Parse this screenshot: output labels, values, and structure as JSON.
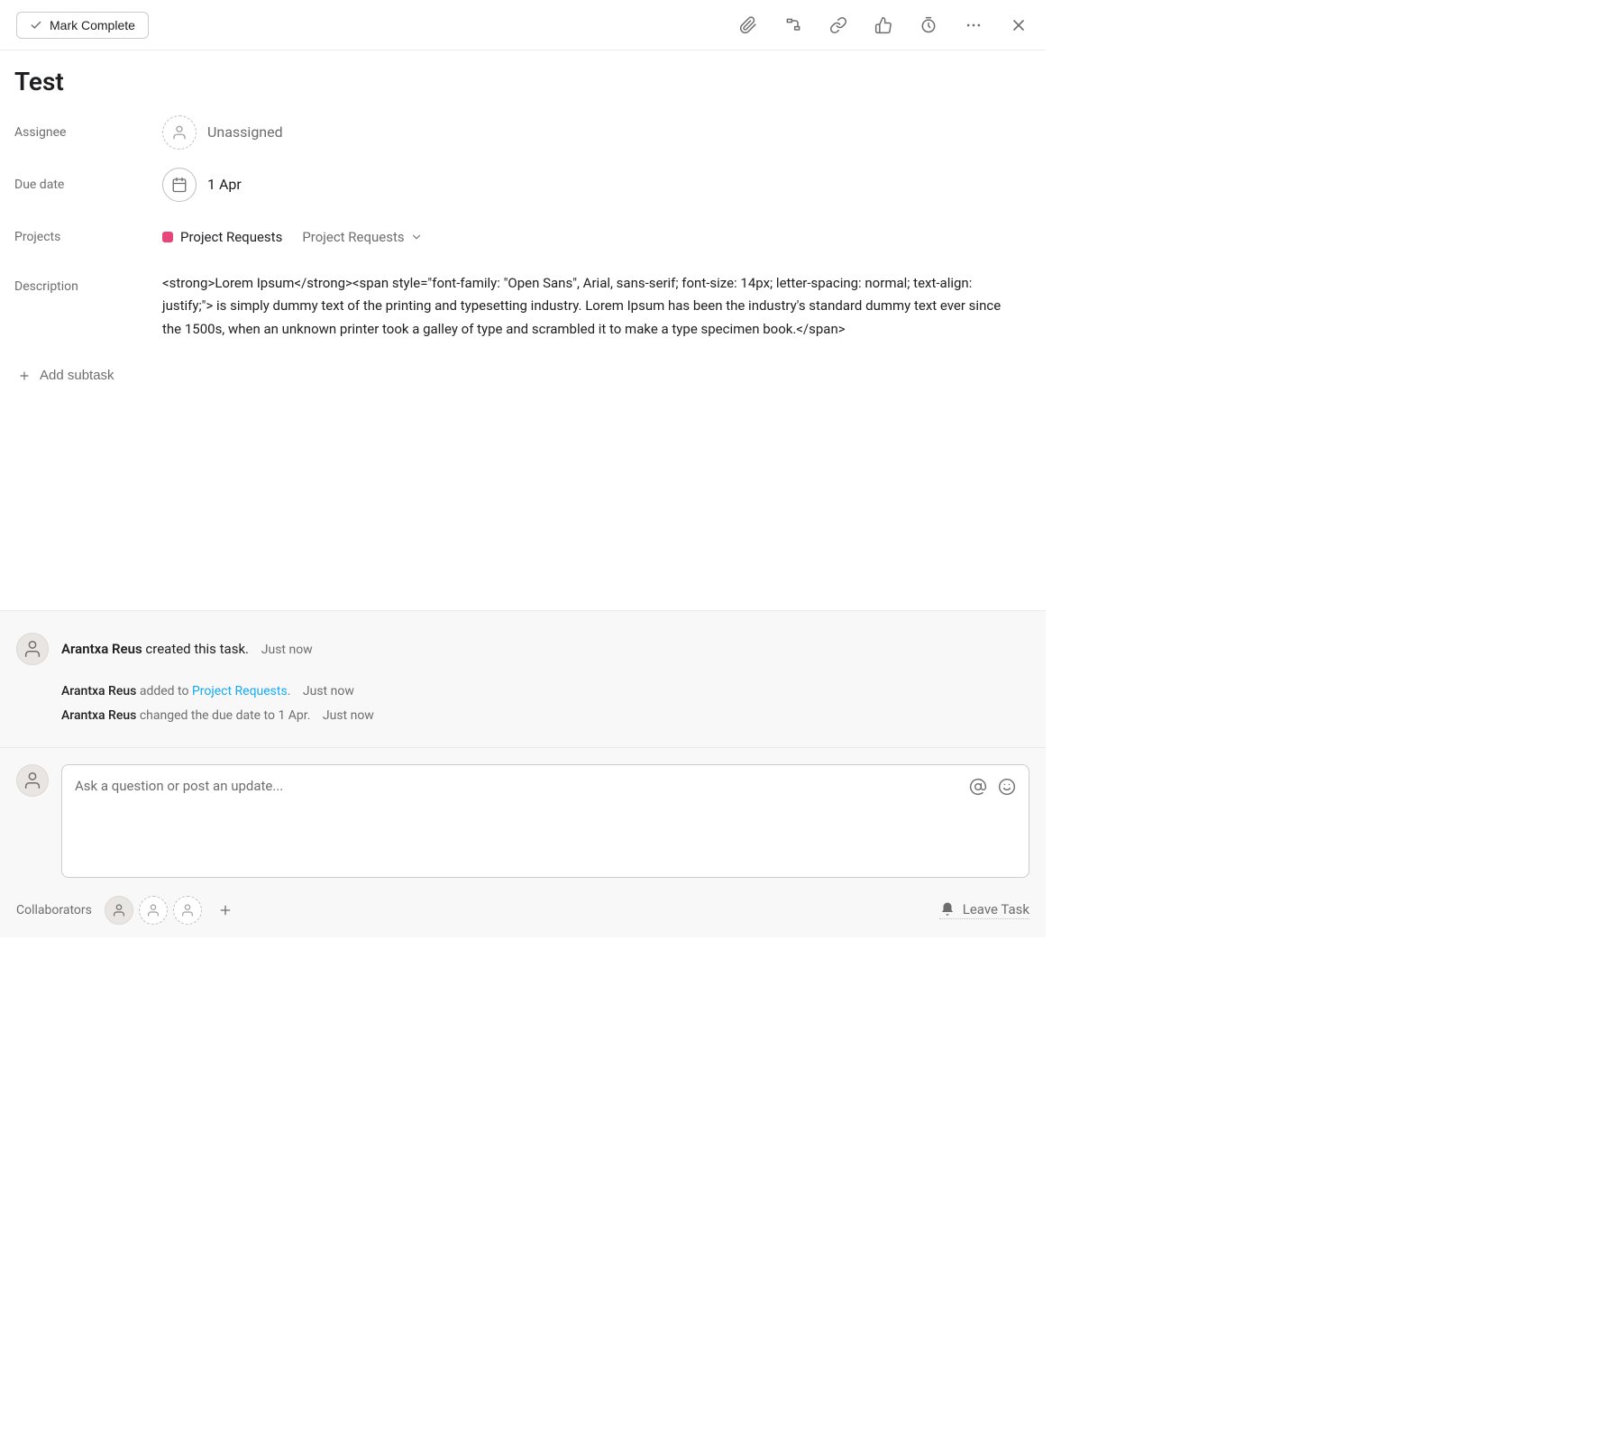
{
  "toolbar": {
    "mark_complete_label": "Mark Complete"
  },
  "task": {
    "title": "Test"
  },
  "fields": {
    "assignee": {
      "label": "Assignee",
      "value": "Unassigned"
    },
    "due_date": {
      "label": "Due date",
      "value": "1 Apr"
    },
    "projects": {
      "label": "Projects",
      "project_name": "Project Requests",
      "section_name": "Project Requests",
      "project_color": "#e8467b"
    },
    "description": {
      "label": "Description",
      "text": "<strong>Lorem Ipsum</strong><span style=\"font-family: \"Open Sans\", Arial, sans-serif; font-size: 14px; letter-spacing: normal; text-align: justify;\"> is simply dummy text of the printing and typesetting industry. Lorem Ipsum has been the industry's standard dummy text ever since the 1500s, when an unknown printer took a galley of type and scrambled it to make a type specimen book.</span>"
    }
  },
  "subtask": {
    "add_label": "Add subtask"
  },
  "activity": {
    "author": "Arantxa Reus",
    "created_text": " created this task.",
    "created_timestamp": "Just now",
    "entries": [
      {
        "author": "Arantxa Reus",
        "action_prefix": " added to ",
        "link_text": "Project Requests",
        "action_suffix": ".",
        "timestamp": "Just now"
      },
      {
        "author": "Arantxa Reus",
        "action_prefix": " changed the due date to 1 Apr.",
        "link_text": "",
        "action_suffix": "",
        "timestamp": "Just now"
      }
    ]
  },
  "comment": {
    "placeholder": "Ask a question or post an update..."
  },
  "collaborators": {
    "label": "Collaborators",
    "leave_label": "Leave Task"
  }
}
